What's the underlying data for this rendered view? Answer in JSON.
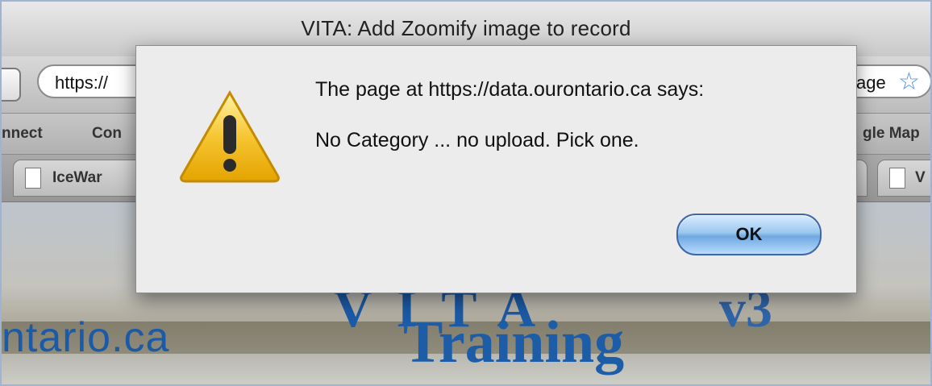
{
  "window": {
    "title": "VITA: Add Zoomify image to record"
  },
  "toolbar": {
    "url_visible": "https://",
    "url_tail_visible": "age"
  },
  "bookmarks": {
    "items": [
      "nnect",
      "Con",
      "gle Map"
    ]
  },
  "tabs": [
    {
      "label": "IceWar"
    },
    {
      "label": "V"
    }
  ],
  "page": {
    "brand_text": "ntario.ca",
    "headline": "Training",
    "banner_fragment": "V"
  },
  "dialog": {
    "message_line1": "The page at https://data.ourontario.ca says:",
    "message_line2": "No Category ... no upload.  Pick one.",
    "ok_label": "OK",
    "icon": "warning-icon"
  },
  "colors": {
    "accent_blue": "#1b5aa6",
    "ok_button": "#9bc8ef",
    "warning_yellow": "#f6c531"
  }
}
